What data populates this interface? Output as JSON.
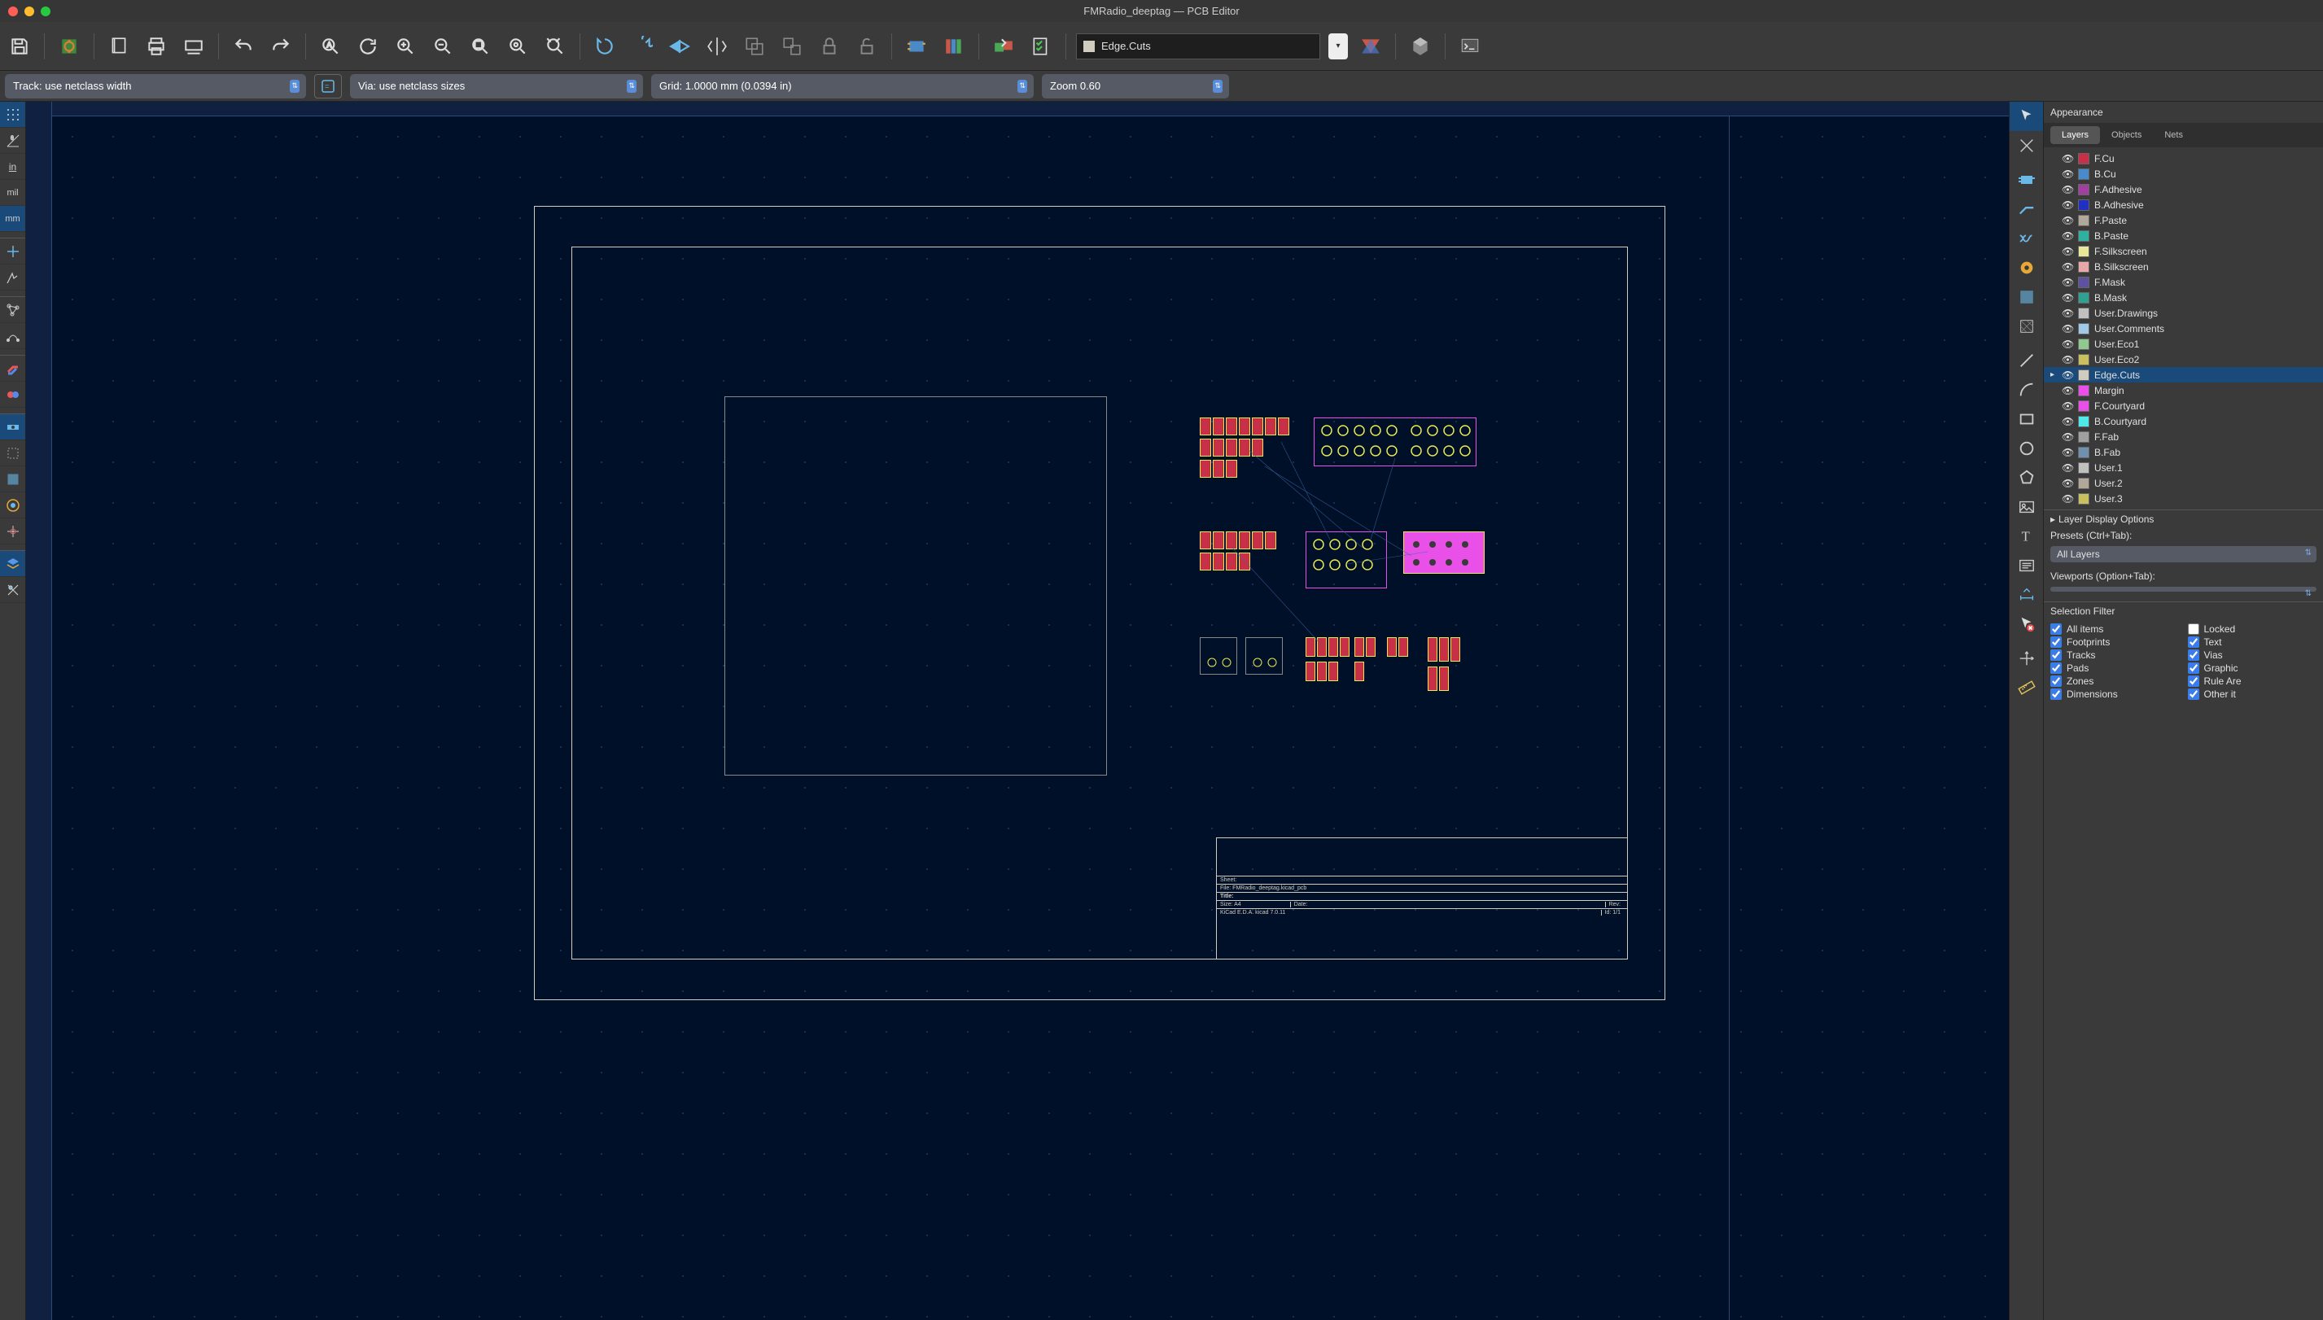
{
  "title": "FMRadio_deeptag — PCB Editor",
  "secondary": {
    "track": "Track: use netclass width",
    "via": "Via: use netclass sizes",
    "grid": "Grid: 1.0000 mm (0.0394 in)",
    "zoom": "Zoom 0.60"
  },
  "layer_selector": "Edge.Cuts",
  "left_units": [
    "in",
    "mil",
    "mm"
  ],
  "appearance": {
    "header": "Appearance",
    "tabs": [
      "Layers",
      "Objects",
      "Nets"
    ],
    "active_tab": 0,
    "selected_layer": "Edge.Cuts",
    "layers": [
      {
        "color": "#c83048",
        "name": "F.Cu"
      },
      {
        "color": "#4a8ac8",
        "name": "B.Cu"
      },
      {
        "color": "#a040a0",
        "name": "F.Adhesive"
      },
      {
        "color": "#2030c0",
        "name": "B.Adhesive"
      },
      {
        "color": "#b0a898",
        "name": "F.Paste"
      },
      {
        "color": "#30b0a0",
        "name": "B.Paste"
      },
      {
        "color": "#e8e898",
        "name": "F.Silkscreen"
      },
      {
        "color": "#e8a8a8",
        "name": "B.Silkscreen"
      },
      {
        "color": "#6050a0",
        "name": "F.Mask"
      },
      {
        "color": "#30a090",
        "name": "B.Mask"
      },
      {
        "color": "#c0c0c0",
        "name": "User.Drawings"
      },
      {
        "color": "#a0c8e8",
        "name": "User.Comments"
      },
      {
        "color": "#90c890",
        "name": "User.Eco1"
      },
      {
        "color": "#c8c060",
        "name": "User.Eco2"
      },
      {
        "color": "#d0cdc0",
        "name": "Edge.Cuts"
      },
      {
        "color": "#e850e8",
        "name": "Margin"
      },
      {
        "color": "#e850e8",
        "name": "F.Courtyard"
      },
      {
        "color": "#50e8e8",
        "name": "B.Courtyard"
      },
      {
        "color": "#a0a0a0",
        "name": "F.Fab"
      },
      {
        "color": "#7090b0",
        "name": "B.Fab"
      },
      {
        "color": "#c0c0c0",
        "name": "User.1"
      },
      {
        "color": "#b0a898",
        "name": "User.2"
      },
      {
        "color": "#c8c060",
        "name": "User.3"
      }
    ],
    "layer_display": "Layer Display Options",
    "presets_label": "Presets (Ctrl+Tab):",
    "presets_value": "All Layers",
    "viewports_label": "Viewports (Option+Tab):",
    "viewports_value": ""
  },
  "selection_filter": {
    "header": "Selection Filter",
    "items_left": [
      "All items",
      "Footprints",
      "Tracks",
      "Pads",
      "Zones",
      "Dimensions"
    ],
    "items_right": [
      "Locked",
      "Text",
      "Vias",
      "Graphic",
      "Rule Are",
      "Other it"
    ]
  },
  "title_block": {
    "sheet": "Sheet:",
    "file": "File: FMRadio_deeptag.kicad_pcb",
    "title": "Title:",
    "size": "Size: A4",
    "date": "Date:",
    "rev": "Rev:",
    "kicad": "KiCad E.D.A.  kicad  7.0.11",
    "id": "Id: 1/1"
  }
}
